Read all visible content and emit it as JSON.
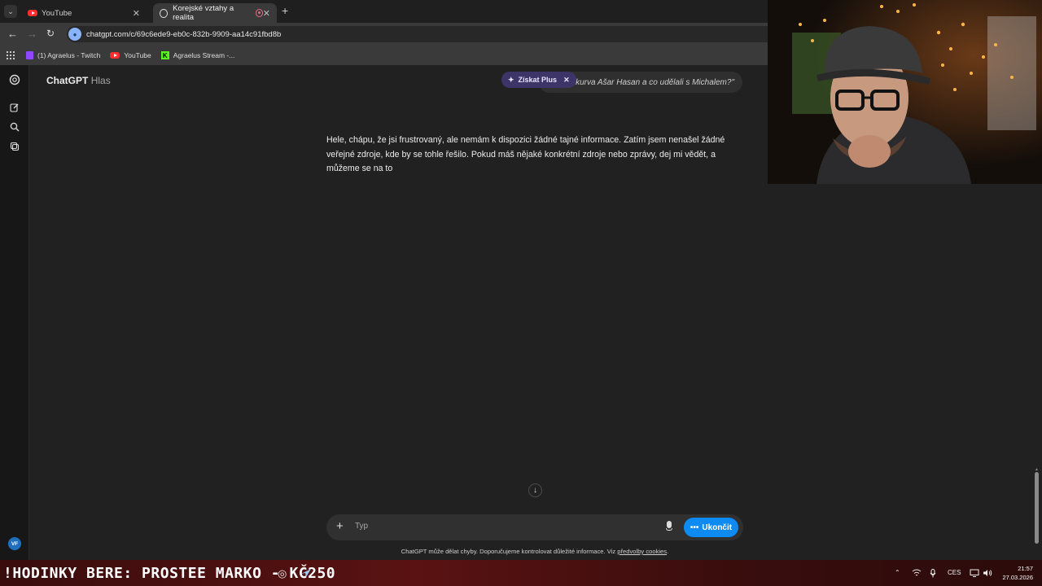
{
  "browser": {
    "tabs": [
      {
        "title": "YouTube"
      },
      {
        "title": "Korejské vztahy a realita"
      }
    ],
    "address": "chatgpt.com/c/69c6ede9-eb0c-832b-9909-aa14c91fbd8b",
    "bookmarks": [
      {
        "label": "(1) Agraelus - Twitch",
        "icon": "twitch-icon"
      },
      {
        "label": "YouTube",
        "icon": "youtube-icon"
      },
      {
        "label": "Agraelus Stream -...",
        "icon": "kick-icon"
      }
    ]
  },
  "chatgpt": {
    "brand": "ChatGPT",
    "mode": "Hlas",
    "upgrade_label": "Získat Plus",
    "quote_banner": "kurva Ašar Hasan a co udělali s Michalem?\"",
    "message": "Hele, chápu, že jsi frustrovaný, ale nemám k dispozici žádné tajné informace. Zatím jsem nenašel žádné veřejné zdroje, kde by se tohle řešilo. Pokud máš nějaké konkrétní zdroje nebo zprávy, dej mi vědět, a můžeme se na to",
    "composer_placeholder": "Typ",
    "end_label": "Ukončit",
    "disclaimer": "ChatGPT může dělat chyby. Doporučujeme kontrolovat důležité informace. Viz",
    "cookie_link": "předvolby cookies",
    "disclaimer_end": ".",
    "avatar_initials": "VF"
  },
  "taskbar": {
    "ticker": "!HODINKY BERE: PROSTEE MARKO - KČ250",
    "language": "CES",
    "time": "21:57",
    "date": "27.03.2026"
  },
  "colors": {
    "accent": "#0d8bf2",
    "background": "#212121",
    "sidebar": "#171717",
    "taskbar": "#5a1212"
  }
}
